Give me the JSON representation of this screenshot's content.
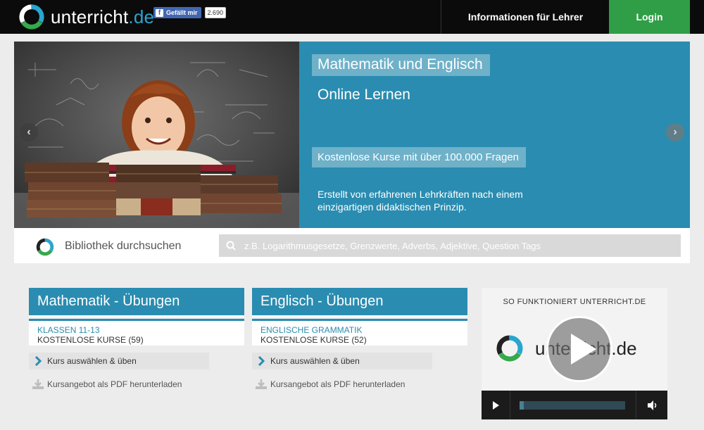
{
  "header": {
    "logo_text": "unterricht",
    "logo_domain": ".de",
    "fb_like_label": "Gefällt mir",
    "fb_like_count": "2.690",
    "nav_teachers": "Informationen für Lehrer",
    "nav_login": "Login"
  },
  "hero": {
    "title": "Mathematik und Englisch",
    "subtitle": "Online Lernen",
    "tag": "Kostenlose Kurse mit über 100.000 Fragen",
    "description": "Erstellt von erfahrenen Lehrkräften nach einem einzigartigen didaktischen Prinzip."
  },
  "search": {
    "label": "Bibliothek durchsuchen",
    "placeholder": "z.B. Logarithmusgesetze, Grenzwerte, Adverbs, Adjektive, Question Tags"
  },
  "cards": [
    {
      "title": "Mathematik - Übungen",
      "class_label": "KLASSEN 11-13",
      "count_label": "KOSTENLOSE KURSE (59)",
      "action_label": "Kurs auswählen & üben",
      "pdf_label": "Kursangebot als PDF herunterladen"
    },
    {
      "title": "Englisch - Übungen",
      "class_label": "ENGLISCHE GRAMMATIK",
      "count_label": "KOSTENLOSE KURSE (52)",
      "action_label": "Kurs auswählen & üben",
      "pdf_label": "Kursangebot als PDF herunterladen"
    }
  ],
  "video": {
    "caption": "SO FUNKTIONIERT UNTERRICHT.DE",
    "logo_text": "unterricht.de",
    "progress": 0.03
  },
  "colors": {
    "accent": "#2a8cb0",
    "login": "#2f9e47",
    "header": "#0b0b0b"
  }
}
